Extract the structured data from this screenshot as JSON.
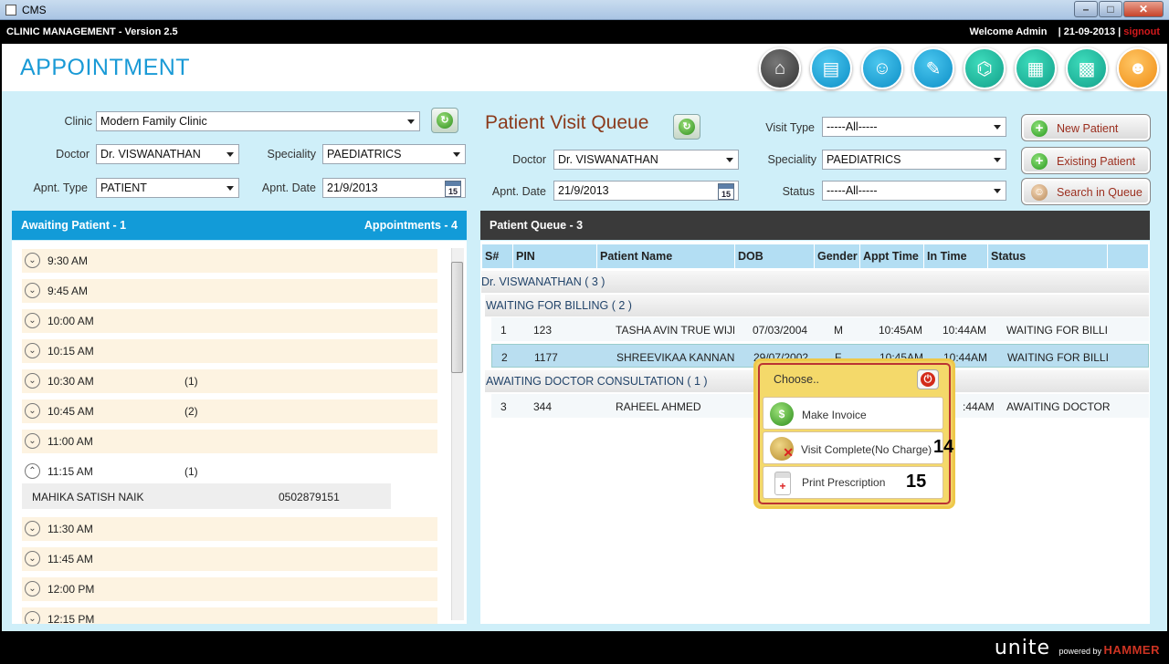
{
  "window": {
    "title": "CMS"
  },
  "appbar": {
    "name": "CLINIC MANAGEMENT - Version 2.5",
    "welcome": "Welcome Admin",
    "sep": "|",
    "date": "21-09-2013",
    "sep2": "|",
    "signout": "signout"
  },
  "page": {
    "title": "APPOINTMENT"
  },
  "nav_icons": [
    "home-icon",
    "notes-icon",
    "nurse-icon",
    "edit-icon",
    "scanner-icon",
    "document-icon",
    "calculator-icon",
    "users-icon"
  ],
  "left_form": {
    "clinic_label": "Clinic",
    "clinic_value": "Modern Family Clinic",
    "doctor_label": "Doctor",
    "doctor_value": "Dr. VISWANATHAN",
    "speciality_label": "Speciality",
    "speciality_value": "PAEDIATRICS",
    "type_label": "Apnt. Type",
    "type_value": "PATIENT",
    "date_label": "Apnt. Date",
    "date_value": "21/9/2013",
    "cal_day": "15"
  },
  "left_panel": {
    "awaiting": "Awaiting Patient - 1",
    "appointments": "Appointments - 4",
    "slots": [
      {
        "time": "9:30 AM",
        "count": ""
      },
      {
        "time": "9:45 AM",
        "count": ""
      },
      {
        "time": "10:00 AM",
        "count": ""
      },
      {
        "time": "10:15 AM",
        "count": ""
      },
      {
        "time": "10:30 AM",
        "count": "(1)"
      },
      {
        "time": "10:45 AM",
        "count": "(2)"
      },
      {
        "time": "11:00 AM",
        "count": ""
      },
      {
        "time": "11:15 AM",
        "count": "(1)"
      },
      {
        "time": "11:30 AM",
        "count": ""
      },
      {
        "time": "11:45 AM",
        "count": ""
      },
      {
        "time": "12:00 PM",
        "count": ""
      },
      {
        "time": "12:15 PM",
        "count": ""
      }
    ],
    "expanded": {
      "name": "MAHIKA SATISH NAIK",
      "phone": "0502879151"
    }
  },
  "queue_form": {
    "title": "Patient Visit Queue",
    "doctor_label": "Doctor",
    "doctor_value": "Dr. VISWANATHAN",
    "date_label": "Apnt. Date",
    "date_value": "21/9/2013",
    "cal_day": "15",
    "visit_type_label": "Visit Type",
    "visit_type_value": "-----All-----",
    "speciality_label": "Speciality",
    "speciality_value": "PAEDIATRICS",
    "status_label": "Status",
    "status_value": "-----All-----"
  },
  "side_buttons": {
    "new_patient": "New Patient",
    "existing_patient": "Existing Patient",
    "search_queue": "Search in Queue"
  },
  "queue": {
    "header": "Patient Queue - 3",
    "columns": [
      "S#",
      "PIN",
      "Patient Name",
      "DOB",
      "Gender",
      "Appt Time",
      "In Time",
      "Status"
    ],
    "doctor_group": "Dr. VISWANATHAN ( 3 )",
    "group_billing": "WAITING FOR BILLING ( 2 )",
    "group_consult": "AWAITING DOCTOR CONSULTATION ( 1 )",
    "rows": [
      {
        "sn": "1",
        "pin": "123",
        "name": "TASHA AVIN TRUE WIJE",
        "dob": "07/03/2004",
        "gender": "M",
        "appt": "10:45AM",
        "in": "10:44AM",
        "status": "WAITING FOR BILLI"
      },
      {
        "sn": "2",
        "pin": "1177",
        "name": "SHREEVIKAA KANNAN",
        "dob": "29/07/2002",
        "gender": "F",
        "appt": "10:45AM",
        "in": "10:44AM",
        "status": "WAITING FOR BILLI"
      },
      {
        "sn": "3",
        "pin": "344",
        "name": "RAHEEL AHMED",
        "dob": "",
        "gender": "",
        "appt": "",
        "in": ":44AM",
        "status": "AWAITING DOCTOR"
      }
    ]
  },
  "popup": {
    "title": "Choose..",
    "make_invoice": "Make Invoice",
    "visit_complete": "Visit Complete(No Charge)",
    "print_prescription": "Print Prescription",
    "label_14": "14",
    "label_15": "15"
  },
  "footer": {
    "brand": "unite",
    "powered": "powered by",
    "company": "HAMMER"
  },
  "colors": {
    "accent": "#1a9ad6",
    "left_header": "#129bd8",
    "queue_header": "#3a3a3a",
    "signout": "#d3191c",
    "queue_title": "#8b3a1b"
  }
}
